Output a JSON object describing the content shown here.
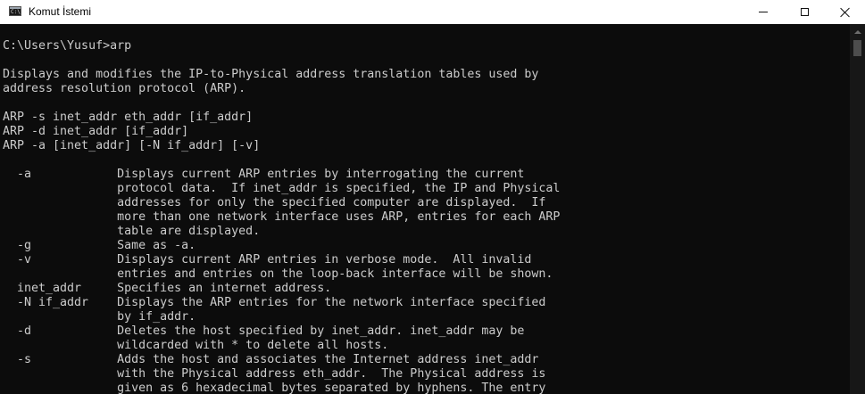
{
  "window": {
    "title": "Komut İstemi",
    "icon": "cmd-icon",
    "icon_text": "C:\\",
    "controls": [
      "minimize-icon",
      "maximize-icon",
      "close-icon"
    ]
  },
  "console": {
    "lines": [
      "C:\\Users\\Yusuf>arp",
      "",
      "Displays and modifies the IP-to-Physical address translation tables used by",
      "address resolution protocol (ARP).",
      "",
      "ARP -s inet_addr eth_addr [if_addr]",
      "ARP -d inet_addr [if_addr]",
      "ARP -a [inet_addr] [-N if_addr] [-v]",
      "",
      "  -a            Displays current ARP entries by interrogating the current",
      "                protocol data.  If inet_addr is specified, the IP and Physical",
      "                addresses for only the specified computer are displayed.  If",
      "                more than one network interface uses ARP, entries for each ARP",
      "                table are displayed.",
      "  -g            Same as -a.",
      "  -v            Displays current ARP entries in verbose mode.  All invalid",
      "                entries and entries on the loop-back interface will be shown.",
      "  inet_addr     Specifies an internet address.",
      "  -N if_addr    Displays the ARP entries for the network interface specified",
      "                by if_addr.",
      "  -d            Deletes the host specified by inet_addr. inet_addr may be",
      "                wildcarded with * to delete all hosts.",
      "  -s            Adds the host and associates the Internet address inet_addr",
      "                with the Physical address eth_addr.  The Physical address is",
      "                given as 6 hexadecimal bytes separated by hyphens. The entry"
    ]
  },
  "colors": {
    "console_bg": "#0c0c0c",
    "console_text": "#cccccc",
    "titlebar_bg": "#ffffff"
  }
}
